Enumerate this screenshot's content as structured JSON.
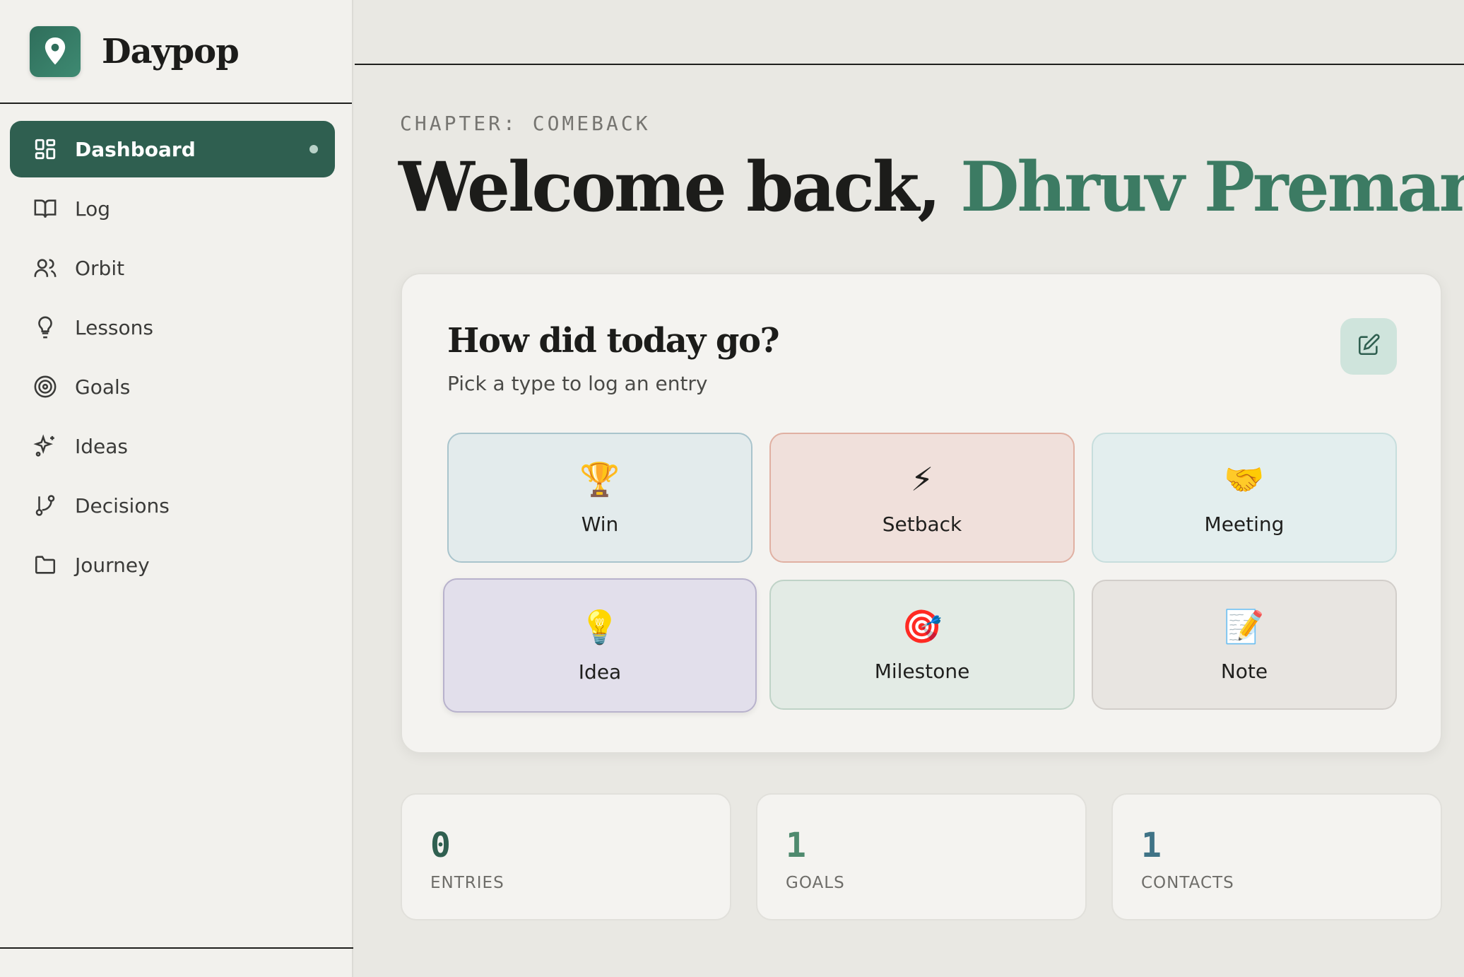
{
  "app": {
    "name": "Daypop",
    "logo_icon": "map-pin-icon"
  },
  "sidebar": {
    "items": [
      {
        "label": "Dashboard",
        "icon": "dashboard-icon",
        "active": true
      },
      {
        "label": "Log",
        "icon": "book-icon"
      },
      {
        "label": "Orbit",
        "icon": "users-icon"
      },
      {
        "label": "Lessons",
        "icon": "lightbulb-icon"
      },
      {
        "label": "Goals",
        "icon": "target-icon"
      },
      {
        "label": "Ideas",
        "icon": "sparkles-icon"
      },
      {
        "label": "Decisions",
        "icon": "git-branch-icon"
      },
      {
        "label": "Journey",
        "icon": "folder-icon"
      }
    ]
  },
  "header": {
    "chapter": "CHAPTER: COMEBACK",
    "welcome_prefix": "Welcome back,",
    "user_name": "Dhruv Premani"
  },
  "log_card": {
    "title": "How did today go?",
    "subtitle": "Pick a type to log an entry",
    "edit_icon": "edit-icon",
    "types": [
      {
        "label": "Win",
        "emoji": "🏆"
      },
      {
        "label": "Setback",
        "emoji": "⚡"
      },
      {
        "label": "Meeting",
        "emoji": "🤝"
      },
      {
        "label": "Idea",
        "emoji": "💡"
      },
      {
        "label": "Milestone",
        "emoji": "🎯"
      },
      {
        "label": "Note",
        "emoji": "📝"
      }
    ]
  },
  "stats": {
    "entries": {
      "value": "0",
      "label": "ENTRIES",
      "color": "#2f5f50"
    },
    "goals": {
      "value": "1",
      "label": "GOALS",
      "color": "#4e8a6e"
    },
    "contacts": {
      "value": "1",
      "label": "CONTACTS",
      "color": "#3f7386"
    }
  },
  "colors": {
    "accent": "#2f5f50",
    "name_green": "#3c7b63",
    "background": "#e9e8e3"
  }
}
